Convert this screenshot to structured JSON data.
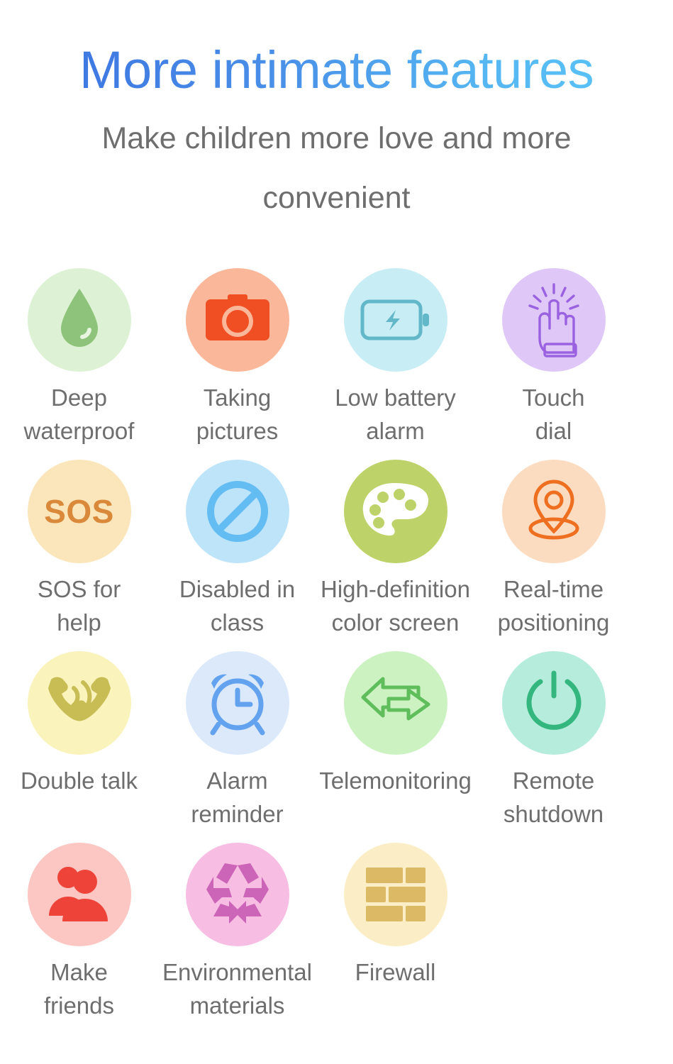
{
  "header": {
    "title": "More intimate features",
    "subtitle": "Make children more love and more convenient",
    "title_gradient_from": "#3a6fe0",
    "title_gradient_to": "#5cc8f8",
    "subtitle_color": "#6e6e6e"
  },
  "features": [
    [
      {
        "label": "Deep\nwaterproof",
        "icon": "water-drop-icon",
        "circle_color": "#ddf2d4",
        "icon_color": "#8dc37a"
      },
      {
        "label": "Taking\npictures",
        "icon": "camera-icon",
        "circle_color": "#fbb79a",
        "icon_color": "#f04e23"
      },
      {
        "label": "Low battery\nalarm",
        "icon": "battery-charging-icon",
        "circle_color": "#c8edf5",
        "icon_color": "#62b7c9"
      },
      {
        "label": "Touch\ndial",
        "icon": "touch-hand-icon",
        "circle_color": "#dfc8f7",
        "icon_color": "#9a62e0"
      }
    ],
    [
      {
        "label": "SOS for\nhelp",
        "icon": "sos-text-icon",
        "icon_text": "SOS",
        "circle_color": "#fbe6bb",
        "icon_color": "#d98939"
      },
      {
        "label": "Disabled in\nclass",
        "icon": "prohibited-icon",
        "circle_color": "#bee4fa",
        "icon_color": "#63bdf3"
      },
      {
        "label": "High-definition\ncolor screen",
        "icon": "paint-palette-icon",
        "circle_color": "#bdd369",
        "icon_color": "#ffffff"
      },
      {
        "label": "Real-time\npositioning",
        "icon": "location-pin-icon",
        "circle_color": "#fcdcc0",
        "icon_color": "#ef6f20"
      }
    ],
    [
      {
        "label": "Double talk",
        "icon": "two-way-call-icon",
        "circle_color": "#faf3bc",
        "icon_color": "#c8bd55"
      },
      {
        "label": "Alarm\nreminder",
        "icon": "alarm-clock-icon",
        "circle_color": "#dbe9fb",
        "icon_color": "#63a2ef"
      },
      {
        "label": "Telemonitoring",
        "icon": "two-way-arrows-icon",
        "circle_color": "#ccf2c2",
        "icon_color": "#5fbd5c"
      },
      {
        "label": "Remote\nshutdown",
        "icon": "power-button-icon",
        "circle_color": "#b6ecdb",
        "icon_color": "#34b77e"
      }
    ],
    [
      {
        "label": "Make\nfriends",
        "icon": "people-group-icon",
        "circle_color": "#fcc6c2",
        "icon_color": "#ed4339"
      },
      {
        "label": "Environmental\nmaterials",
        "icon": "recycle-icon",
        "circle_color": "#f7bde3",
        "icon_color": "#cc64b8"
      },
      {
        "label": "Firewall",
        "icon": "brick-wall-icon",
        "circle_color": "#fbeec6",
        "icon_color": "#dcb964"
      }
    ]
  ]
}
